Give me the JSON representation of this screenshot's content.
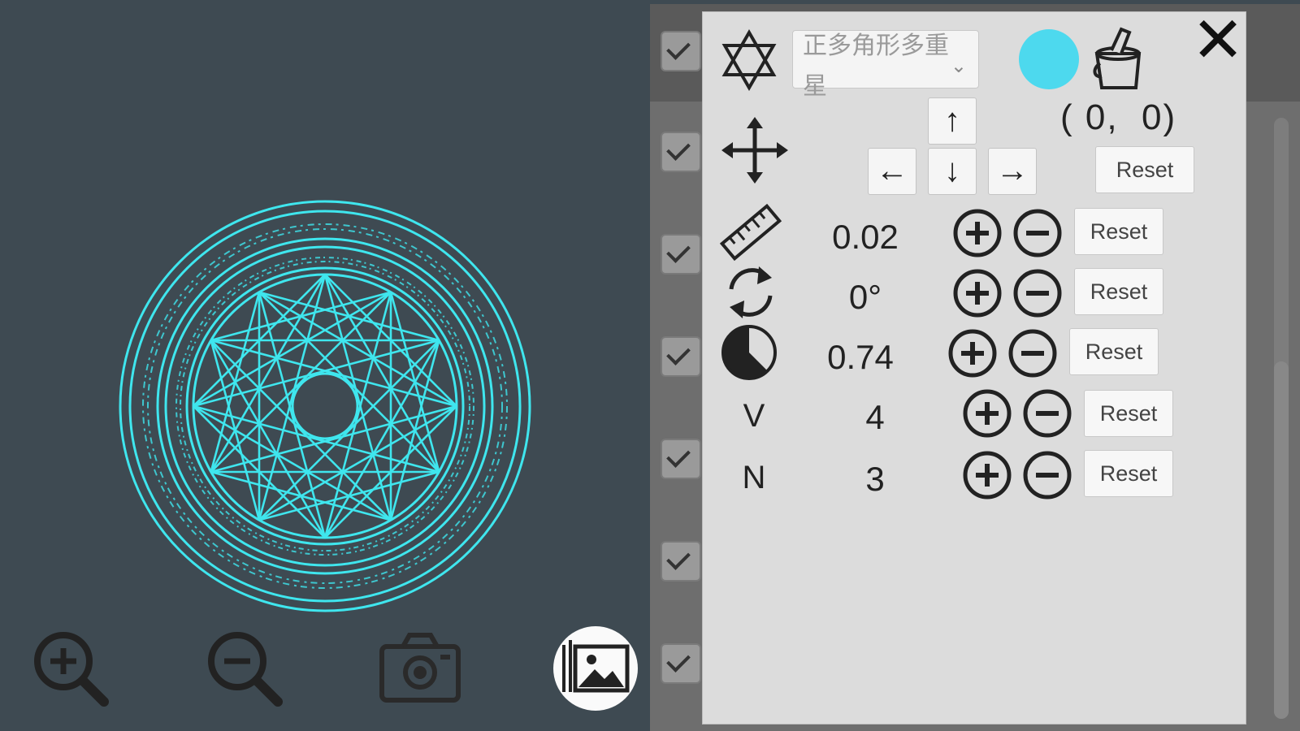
{
  "panel": {
    "shape_dropdown": {
      "selected": "正多角形多重星"
    },
    "color": "#4dd9ee",
    "position_readout": "( 0,  0)",
    "close_label": "✕",
    "arrows": {
      "up": "↑",
      "down": "↓",
      "left": "←",
      "right": "→"
    },
    "reset_label": "Reset",
    "rows": [
      {
        "value": "0.02"
      },
      {
        "value": "0°"
      },
      {
        "value": "0.74"
      },
      {
        "label": "V",
        "value": "4"
      },
      {
        "label": "N",
        "value": "3"
      }
    ]
  },
  "canvas": {
    "glow_color": "#3fe6ee"
  },
  "icons": {
    "toolbar_star": "star-of-david-icon",
    "paint_bucket": "paint-bucket-icon",
    "move": "move-arrows-icon",
    "scale": "ruler-icon",
    "rotate": "rotate-icon",
    "ratio": "pie-icon",
    "zoom_in": "zoom-in-icon",
    "zoom_out": "zoom-out-icon",
    "camera": "camera-icon",
    "gallery": "image-gallery-icon"
  }
}
